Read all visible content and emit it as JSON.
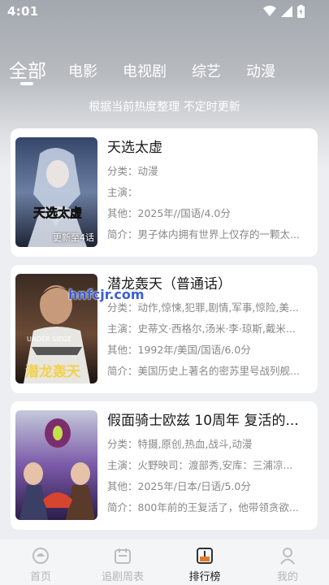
{
  "status_bar": {
    "time": "4:01"
  },
  "tabs": [
    {
      "label": "全部",
      "active": true
    },
    {
      "label": "电影"
    },
    {
      "label": "电视剧"
    },
    {
      "label": "综艺"
    },
    {
      "label": "动漫"
    }
  ],
  "subtitle": "根据当前热度整理 不定时更新",
  "cards": [
    {
      "title": "天选太虚",
      "genre": "分类：动漫",
      "cast": "主演：",
      "other": "其他：2025年//国语/4.0分",
      "intro": "简介：男子体内拥有世界上仅存的一颗太...",
      "badge": "更新至4话",
      "poster_text": "天选太虚"
    },
    {
      "title": "潜龙轰天（普通话）",
      "genre": "分类：动作,惊悚,犯罪,剧情,军事,惊险,美...",
      "cast": "主演：史蒂文·西格尔,汤米·李·琼斯,戴米...",
      "other": "其他：1992年/美国/国语/6.0分",
      "intro": "简介：美国历史上著名的密苏里号战列舰...",
      "poster_text_en": "UNDER SIEGE",
      "poster_text": "潜龙轰天"
    },
    {
      "title": "假面骑士欧兹 10周年 复活的...",
      "genre": "分类：特摄,原创,热血,战斗,动漫",
      "cast": "主演：火野映司：渡部秀,安库：三浦凉...",
      "other": "其他：2025年/日本/日语/5.0分",
      "intro": "简介：800年前的王复活了，他带领贪欲..."
    }
  ],
  "watermark": "hnfcjr.com",
  "bottom_nav": [
    {
      "label": "首页",
      "icon": "home-icon"
    },
    {
      "label": "追剧周表",
      "icon": "calendar-icon"
    },
    {
      "label": "排行榜",
      "icon": "ranking-icon",
      "active": true
    },
    {
      "label": "我的",
      "icon": "profile-icon"
    }
  ],
  "colors": {
    "accent": "#e07a2a",
    "watermark": "#3a5ed6"
  }
}
